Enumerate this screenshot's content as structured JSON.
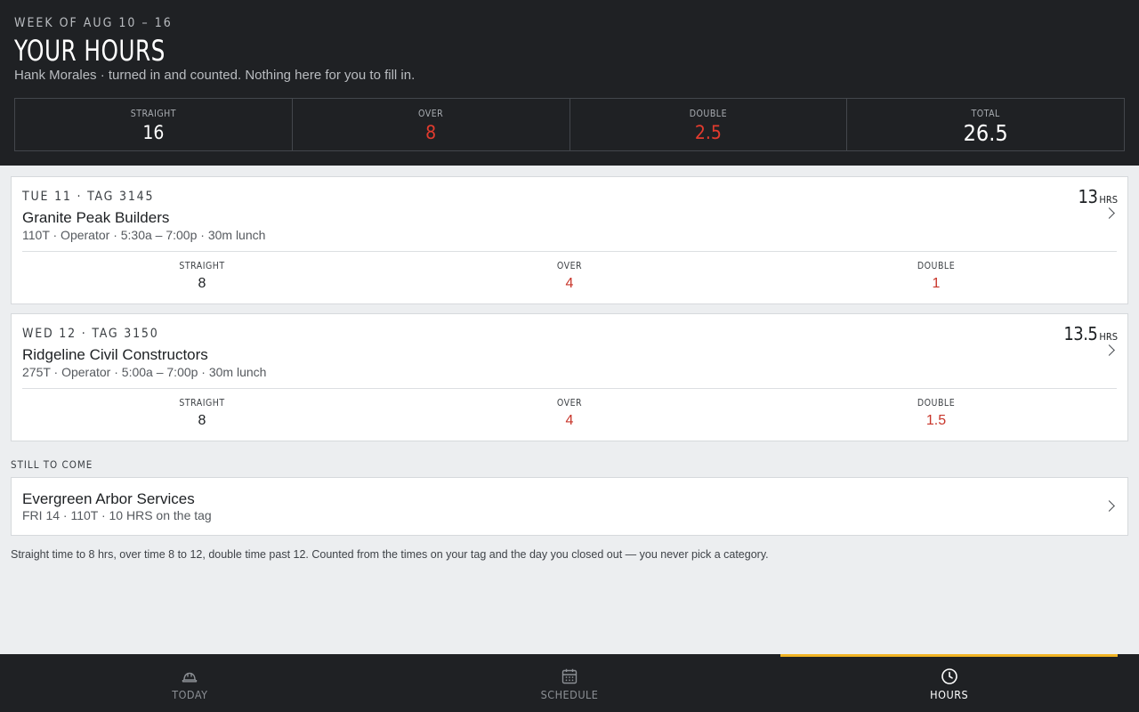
{
  "header": {
    "week": "WEEK OF AUG 10 – 16",
    "title": "YOUR HOURS",
    "subtitle": "Hank Morales · turned in and counted. Nothing here for you to fill in."
  },
  "totals": {
    "straight_label": "STRAIGHT",
    "straight": "16",
    "over_label": "OVER",
    "over": "8",
    "double_label": "DOUBLE",
    "double": "2.5",
    "total_label": "TOTAL",
    "total": "26.5"
  },
  "entries": [
    {
      "daytag": "TUE 11 · TAG 3145",
      "company": "Granite Peak Builders",
      "meta": "110T · Operator · 5:30a – 7:00p · 30m lunch",
      "hours": "13",
      "hours_unit": "HRS",
      "straight_label": "STRAIGHT",
      "straight": "8",
      "over_label": "OVER",
      "over": "4",
      "double_label": "DOUBLE",
      "double": "1"
    },
    {
      "daytag": "WED 12 · TAG 3150",
      "company": "Ridgeline Civil Constructors",
      "meta": "275T · Operator · 5:00a – 7:00p · 30m lunch",
      "hours": "13.5",
      "hours_unit": "HRS",
      "straight_label": "STRAIGHT",
      "straight": "8",
      "over_label": "OVER",
      "over": "4",
      "double_label": "DOUBLE",
      "double": "1.5"
    }
  ],
  "upcoming": {
    "section_label": "STILL TO COME",
    "company": "Evergreen Arbor Services",
    "meta": "FRI 14 · 110T · 10 HRS on the tag"
  },
  "note": "Straight time to 8 hrs, over time 8 to 12, double time past 12. Counted from the times on your tag and the day you closed out — you never pick a category.",
  "nav": {
    "today": "TODAY",
    "schedule": "SCHEDULE",
    "hours": "HOURS",
    "active": "hours"
  },
  "colors": {
    "header_bg": "#1f2124",
    "accent": "#f0b323",
    "overtime_red": "#c8352a"
  }
}
